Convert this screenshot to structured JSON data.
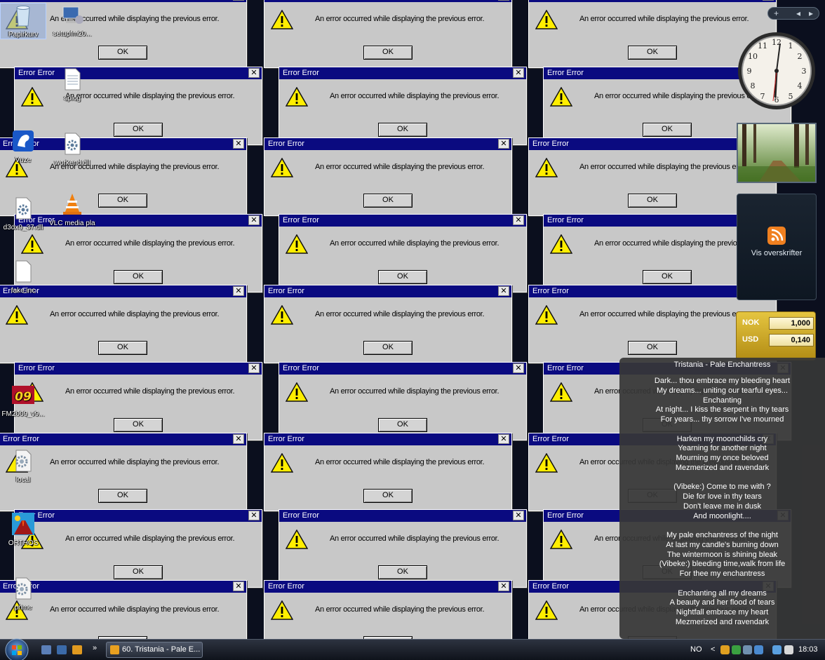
{
  "dialog": {
    "title": "Error Error",
    "message": "An error occurred while displaying the previous error.",
    "ok_label": "OK",
    "close_glyph": "✕"
  },
  "desktop_icons": [
    {
      "label": "Papirkurv",
      "icon": "recycle-bin-icon"
    },
    {
      "label": "setupfm20...",
      "icon": "setup-icon"
    },
    {
      "label": "splog",
      "icon": "text-file-icon"
    },
    {
      "label": "Vuze",
      "icon": "vuze-frog-icon"
    },
    {
      "label": "workend.dll",
      "icon": "dll-gear-icon"
    },
    {
      "label": "d3dx9_37.dll",
      "icon": "dll-gear-icon"
    },
    {
      "label": "VLC media player",
      "icon": "vlc-cone-icon"
    },
    {
      "label": "fake.inc",
      "icon": "blank-file-icon"
    },
    {
      "label": "FM2009_v9...",
      "icon": "fm09-icon"
    },
    {
      "label": "local",
      "icon": "settings-file-icon"
    },
    {
      "label": "ORTHOS",
      "icon": "orthos-volcano-icon"
    },
    {
      "label": "prime",
      "icon": "settings-file-icon"
    }
  ],
  "sidebar": {
    "add_glyph": "+",
    "prev_glyph": "◂",
    "next_glyph": "▸",
    "feed_label": "Vis overskrifter",
    "currency": [
      {
        "code": "NOK",
        "value": "1,000"
      },
      {
        "code": "USD",
        "value": "0,140"
      }
    ]
  },
  "lyrics": {
    "title": "Tristania - Pale Enchantress",
    "lines": [
      "Dark... thou embrace my bleeding heart",
      "My dreams... uniting our tearful eyes...",
      "Enchanting",
      "At night... I kiss the serpent in thy tears",
      "For years... thy sorrow I've mourned",
      "",
      "Harken my moonchilds cry",
      "Yearning for another night",
      "Mourning my once beloved",
      "Mezmerized and ravendark",
      "",
      "(Vibeke:) Come to me with ?",
      "Die for love in thy tears",
      "Don't leave me in dusk",
      "And moonlight....",
      "",
      "My pale enchantress of the night",
      "At last my candle's burning down",
      "The wintermoon is shining bleak",
      "(Vibeke:) bleeding time,walk from life",
      "For thee my enchantress",
      "",
      "Enchanting all my dreams",
      "A beauty and her flood of tears",
      "Nightfall embrace my heart",
      "Mezmerized and ravendark"
    ]
  },
  "taskbar": {
    "overflow_glyph": "»",
    "task_label": "60. Tristania - Pale E...",
    "language": "NO",
    "tray_arrow": "<",
    "time": "18:03"
  }
}
